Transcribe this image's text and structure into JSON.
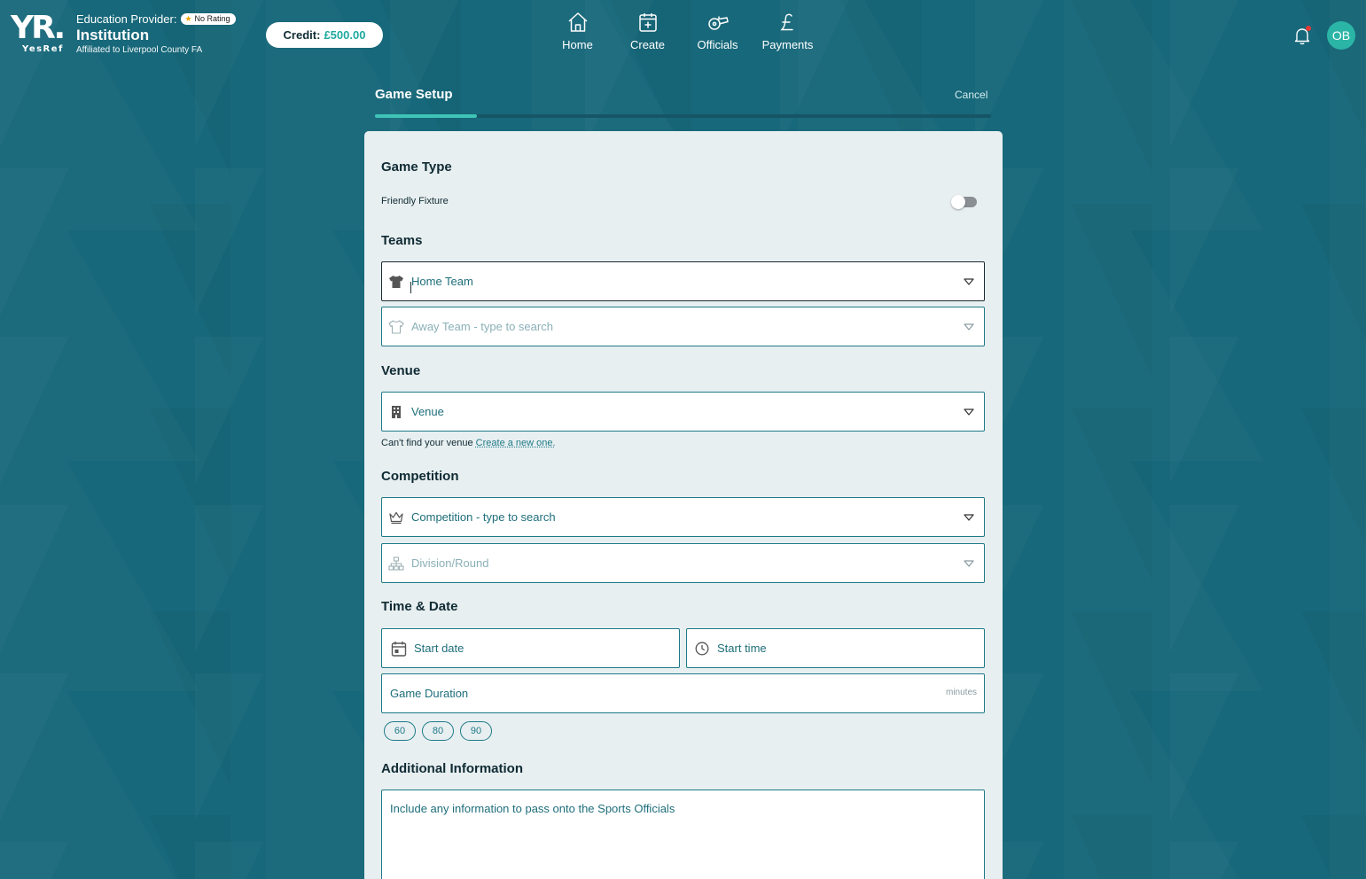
{
  "header": {
    "logo_mark": "YR.",
    "logo_word": "YesRef",
    "provider_label": "Education Provider:",
    "rating_badge": "No Rating",
    "institution_name": "Institution",
    "affiliation": "Affiliated to Liverpool County FA",
    "credit_label": "Credit:",
    "credit_amount": "£500.00",
    "nav": [
      {
        "label": "Home",
        "icon": "home-icon"
      },
      {
        "label": "Create",
        "icon": "calendar-plus-icon"
      },
      {
        "label": "Officials",
        "icon": "whistle-icon"
      },
      {
        "label": "Payments",
        "icon": "pound-icon"
      }
    ],
    "notification_icon": "bell-icon",
    "has_unread_notifications": true,
    "avatar_initials": "OB"
  },
  "setup": {
    "title": "Game Setup",
    "cancel_label": "Cancel",
    "progress_fraction": 0.166
  },
  "form": {
    "game_type_heading": "Game Type",
    "friendly_label": "Friendly Fixture",
    "friendly_on": false,
    "teams_heading": "Teams",
    "home_team_placeholder": "Home Team",
    "away_team_placeholder": "Away Team - type to search",
    "venue_heading": "Venue",
    "venue_placeholder": "Venue",
    "venue_note": "Can't find your venue",
    "venue_create_link": "Create a new one.",
    "competition_heading": "Competition",
    "competition_placeholder": "Competition - type to search",
    "division_placeholder": "Division/Round",
    "time_heading": "Time & Date",
    "start_date_placeholder": "Start date",
    "start_time_placeholder": "Start time",
    "duration_placeholder": "Game Duration",
    "duration_unit": "minutes",
    "duration_options": [
      "60",
      "80",
      "90"
    ],
    "additional_heading": "Additional Information",
    "additional_placeholder": "Include any information to pass onto the Sports Officials"
  },
  "colors": {
    "background": "#17687a",
    "accent": "#3fc4b6",
    "credit_amount": "#1fa9a0",
    "field_border": "#1e7a87",
    "notification_dot": "#e53935"
  }
}
